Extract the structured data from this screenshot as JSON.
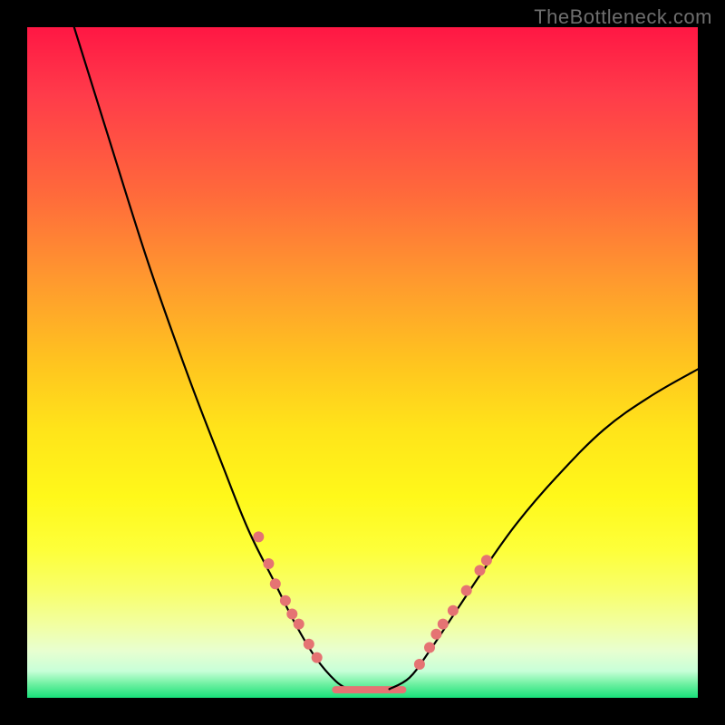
{
  "watermark": "TheBottleneck.com",
  "chart_data": {
    "type": "line",
    "title": "",
    "xlabel": "",
    "ylabel": "",
    "xlim": [
      0,
      100
    ],
    "ylim": [
      0,
      100
    ],
    "grid": false,
    "legend": false,
    "background_gradient": {
      "direction": "vertical",
      "stops": [
        {
          "pos": 0,
          "color": "#ff1744"
        },
        {
          "pos": 10,
          "color": "#ff3b4a"
        },
        {
          "pos": 25,
          "color": "#ff6a3b"
        },
        {
          "pos": 38,
          "color": "#ff9a2e"
        },
        {
          "pos": 50,
          "color": "#ffc41f"
        },
        {
          "pos": 60,
          "color": "#ffe41a"
        },
        {
          "pos": 70,
          "color": "#fff81a"
        },
        {
          "pos": 78,
          "color": "#fdff3a"
        },
        {
          "pos": 84,
          "color": "#f8ff6a"
        },
        {
          "pos": 89,
          "color": "#f2ffa0"
        },
        {
          "pos": 93,
          "color": "#e8ffd0"
        },
        {
          "pos": 96,
          "color": "#c8ffd8"
        },
        {
          "pos": 98,
          "color": "#6cf0a0"
        },
        {
          "pos": 100,
          "color": "#18e07a"
        }
      ]
    },
    "series": [
      {
        "name": "left-branch",
        "stroke": "#000000",
        "stroke_width": 2.2,
        "points": [
          {
            "x": 7,
            "y": 100
          },
          {
            "x": 12,
            "y": 84
          },
          {
            "x": 18,
            "y": 65
          },
          {
            "x": 24,
            "y": 48
          },
          {
            "x": 29,
            "y": 35
          },
          {
            "x": 33,
            "y": 25
          },
          {
            "x": 37,
            "y": 17
          },
          {
            "x": 40,
            "y": 11
          },
          {
            "x": 43,
            "y": 6
          },
          {
            "x": 46,
            "y": 2.5
          },
          {
            "x": 48,
            "y": 1.2
          }
        ]
      },
      {
        "name": "flat-bottom",
        "stroke": "#e57373",
        "stroke_width": 8,
        "points": [
          {
            "x": 46,
            "y": 1.2
          },
          {
            "x": 56,
            "y": 1.2
          }
        ]
      },
      {
        "name": "right-branch",
        "stroke": "#000000",
        "stroke_width": 2.2,
        "points": [
          {
            "x": 54,
            "y": 1.3
          },
          {
            "x": 57,
            "y": 3
          },
          {
            "x": 60,
            "y": 7
          },
          {
            "x": 64,
            "y": 13
          },
          {
            "x": 68,
            "y": 19
          },
          {
            "x": 73,
            "y": 26
          },
          {
            "x": 79,
            "y": 33
          },
          {
            "x": 86,
            "y": 40
          },
          {
            "x": 93,
            "y": 45
          },
          {
            "x": 100,
            "y": 49
          }
        ]
      }
    ],
    "marker_clusters": [
      {
        "name": "left-markers",
        "color": "#e57373",
        "radius": 6,
        "points": [
          {
            "x": 34.5,
            "y": 24
          },
          {
            "x": 36.0,
            "y": 20
          },
          {
            "x": 37.0,
            "y": 17
          },
          {
            "x": 38.5,
            "y": 14.5
          },
          {
            "x": 39.5,
            "y": 12.5
          },
          {
            "x": 40.5,
            "y": 11
          },
          {
            "x": 42.0,
            "y": 8
          },
          {
            "x": 43.2,
            "y": 6
          }
        ]
      },
      {
        "name": "right-markers",
        "color": "#e57373",
        "radius": 6,
        "points": [
          {
            "x": 58.5,
            "y": 5
          },
          {
            "x": 60.0,
            "y": 7.5
          },
          {
            "x": 61.0,
            "y": 9.5
          },
          {
            "x": 62.0,
            "y": 11
          },
          {
            "x": 63.5,
            "y": 13
          },
          {
            "x": 65.5,
            "y": 16
          },
          {
            "x": 67.5,
            "y": 19
          },
          {
            "x": 68.5,
            "y": 20.5
          }
        ]
      }
    ]
  }
}
